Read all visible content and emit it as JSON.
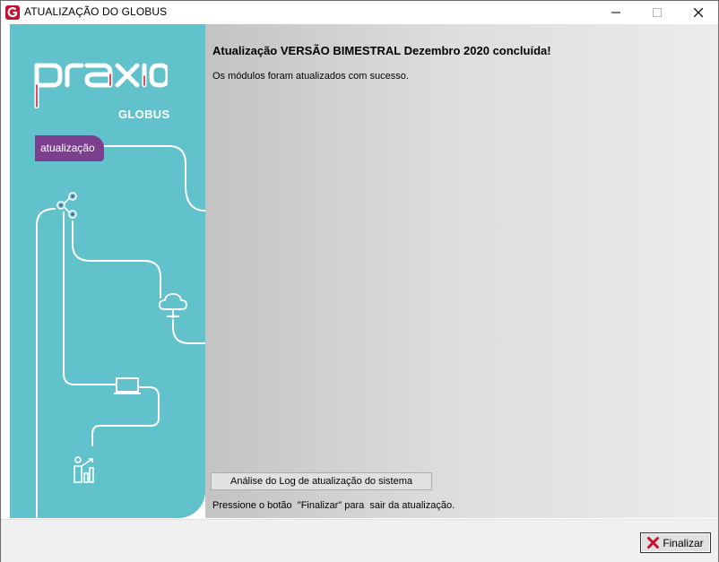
{
  "window": {
    "title": "ATUALIZAÇÃO DO GLOBUS",
    "icon": "globus-g-icon",
    "controls": [
      "minimize",
      "maximize",
      "close"
    ]
  },
  "banner": {
    "brand": "praxio",
    "product": "GLOBUS",
    "tag": "atualização",
    "colors": {
      "background": "#62c2cc",
      "tag": "#7b3f8e",
      "accent": "#c8102e"
    }
  },
  "main": {
    "heading": "Atualização VERSÃO BIMESTRAL Dezembro 2020 concluída!",
    "message": "Os módulos foram atualizados com sucesso.",
    "log_button_label": "Análise do Log de atualização do sistema",
    "hint": "Pressione o botão  \"Finalizar\" para  sair da atualização."
  },
  "footer": {
    "finish_label": "Finalizar",
    "finish_icon": "red-x-icon"
  }
}
